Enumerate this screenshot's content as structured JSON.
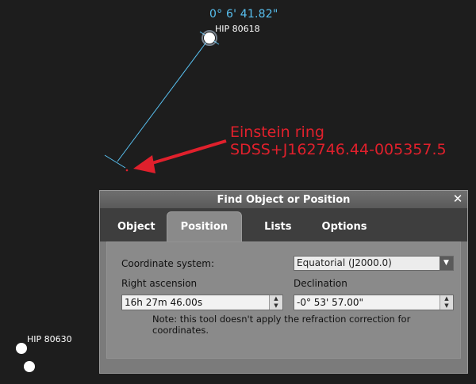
{
  "sky": {
    "angle_readout": "0° 6' 41.82\"",
    "star_top_label": "HIP 80618",
    "star_bottom_label": "HIP 80630",
    "annotation_line1": "Einstein ring",
    "annotation_line2": "SDSS+J162746.44-005357.5",
    "annotation_color": "#e0202c",
    "readout_color": "#58c0f0"
  },
  "dialog": {
    "title": "Find Object or Position",
    "close_icon": "close-icon",
    "tabs": [
      {
        "label": "Object",
        "active": false
      },
      {
        "label": "Position",
        "active": true
      },
      {
        "label": "Lists",
        "active": false
      },
      {
        "label": "Options",
        "active": false
      }
    ],
    "coordinate_system_label": "Coordinate system:",
    "coordinate_system_value": "Equatorial (J2000.0)",
    "ra_label": "Right ascension",
    "ra_value": "16h 27m 46.00s",
    "dec_label": "Declination",
    "dec_value": "-0° 53' 57.00\"",
    "note": "Note: this tool doesn't apply the refraction correction for coordinates."
  }
}
